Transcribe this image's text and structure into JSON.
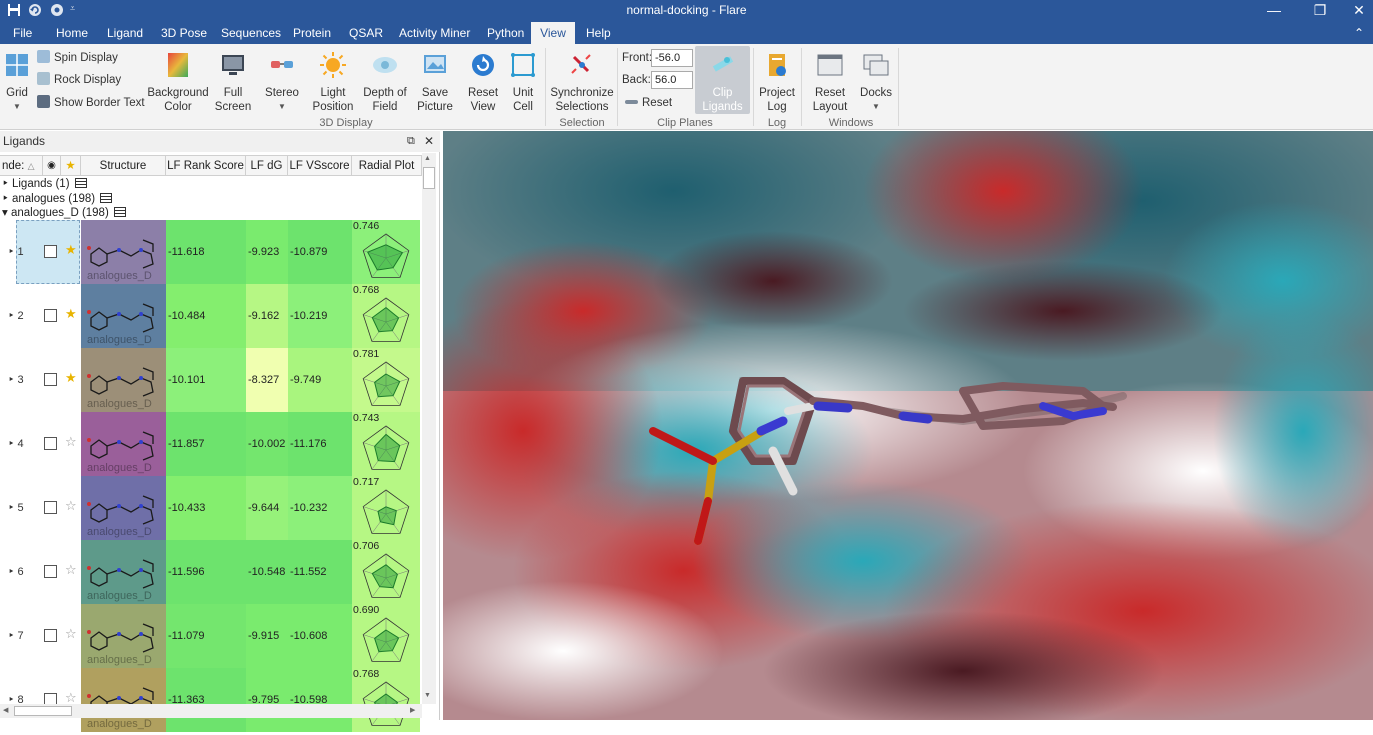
{
  "window": {
    "title": "normal-docking - Flare",
    "minimize": "—",
    "maximize": "❐",
    "close": "✕",
    "collapse_ribbon": "⌃"
  },
  "menu": {
    "items": [
      "File",
      "Home",
      "Ligand",
      "3D Pose",
      "Sequences",
      "Protein",
      "QSAR",
      "Activity Miner",
      "Python",
      "View",
      "Help"
    ],
    "active": "View"
  },
  "ribbon": {
    "grid": "Grid",
    "spin_display": "Spin Display",
    "rock_display": "Rock Display",
    "show_border_text": "Show Border Text",
    "background_color": "Background\nColor",
    "full_screen": "Full\nScreen",
    "stereo": "Stereo",
    "light_position": "Light\nPosition",
    "depth_of_field": "Depth of\nField",
    "save_picture": "Save\nPicture",
    "reset_view": "Reset\nView",
    "unit_cell": "Unit\nCell",
    "group_3d_display": "3D Display",
    "synchronize_selections": "Synchronize\nSelections",
    "group_selection": "Selection",
    "front_label": "Front:",
    "front_value": "-56.0",
    "back_label": "Back:",
    "back_value": "56.0",
    "reset": "Reset",
    "clip_ligands": "Clip\nLigands",
    "group_clip_planes": "Clip Planes",
    "project_log": "Project\nLog",
    "group_log": "Log",
    "reset_layout": "Reset\nLayout",
    "docks": "Docks",
    "group_windows": "Windows"
  },
  "ligands_panel": {
    "title": "Ligands",
    "columns": {
      "index": "nde:",
      "structure": "Structure",
      "lf_rank_score": "LF Rank Score",
      "lf_dg": "LF dG",
      "lf_vsscore": "LF VSscore",
      "radial_plot": "Radial Plot"
    },
    "tree": [
      {
        "label": "Ligands (1)"
      },
      {
        "label": "analogues (198)"
      },
      {
        "label": "analogues_D (198)"
      }
    ],
    "rows": [
      {
        "index": "1",
        "starred": true,
        "struct_label": "analogues_D",
        "rank": "-11.618",
        "dg": "-9.923",
        "vs": "-10.879",
        "radial": "0.746",
        "struct_bg": "#8c7fa8",
        "rank_bg": "#6de36d",
        "dg_bg": "#7aeb6e",
        "vs_bg": "#6de36d",
        "radial_bg": "#8cf07a",
        "shape": [
          0.55,
          0.72,
          0.5,
          0.62,
          0.8
        ]
      },
      {
        "index": "2",
        "starred": true,
        "struct_label": "analogues_D",
        "rank": "-10.484",
        "dg": "-9.162",
        "vs": "-10.219",
        "radial": "0.768",
        "struct_bg": "#5e7fa0",
        "rank_bg": "#84ee6e",
        "dg_bg": "#b6f784",
        "vs_bg": "#8cf07a",
        "radial_bg": "#b6f784",
        "shape": [
          0.6,
          0.55,
          0.45,
          0.5,
          0.6
        ]
      },
      {
        "index": "3",
        "starred": true,
        "struct_label": "analogues_D",
        "rank": "-10.101",
        "dg": "-8.327",
        "vs": "-9.749",
        "radial": "0.781",
        "struct_bg": "#9c8f78",
        "rank_bg": "#8cf07a",
        "dg_bg": "#f0ffb0",
        "vs_bg": "#a9f57e",
        "radial_bg": "#c4f98c",
        "shape": [
          0.5,
          0.6,
          0.5,
          0.55,
          0.5
        ]
      },
      {
        "index": "4",
        "starred": false,
        "struct_label": "analogues_D",
        "rank": "-11.857",
        "dg": "-10.002",
        "vs": "-11.176",
        "radial": "0.743",
        "struct_bg": "#9a5f9a",
        "rank_bg": "#6de36d",
        "dg_bg": "#74e66e",
        "vs_bg": "#6de36d",
        "radial_bg": "#b6f784",
        "shape": [
          0.65,
          0.6,
          0.6,
          0.55,
          0.5
        ]
      },
      {
        "index": "5",
        "starred": false,
        "struct_label": "analogues_D",
        "rank": "-10.433",
        "dg": "-9.644",
        "vs": "-10.232",
        "radial": "0.717",
        "struct_bg": "#6f6fa8",
        "rank_bg": "#84ee6e",
        "dg_bg": "#96f27a",
        "vs_bg": "#8cf07a",
        "radial_bg": "#b6f784",
        "shape": [
          0.3,
          0.45,
          0.55,
          0.4,
          0.35
        ]
      },
      {
        "index": "6",
        "starred": false,
        "struct_label": "analogues_D",
        "rank": "-11.596",
        "dg": "-10.548",
        "vs": "-11.552",
        "radial": "0.706",
        "struct_bg": "#5e9a8a",
        "rank_bg": "#6de36d",
        "dg_bg": "#6de36d",
        "vs_bg": "#6de36d",
        "radial_bg": "#b6f784",
        "shape": [
          0.55,
          0.5,
          0.5,
          0.45,
          0.6
        ]
      },
      {
        "index": "7",
        "starred": false,
        "struct_label": "analogues_D",
        "rank": "-11.079",
        "dg": "-9.915",
        "vs": "-10.608",
        "radial": "0.690",
        "struct_bg": "#9aa86f",
        "rank_bg": "#74e66e",
        "dg_bg": "#7aeb6e",
        "vs_bg": "#7aeb6e",
        "radial_bg": "#b6f784",
        "shape": [
          0.5,
          0.55,
          0.45,
          0.5,
          0.5
        ]
      },
      {
        "index": "8",
        "starred": false,
        "struct_label": "analogues_D",
        "rank": "-11.363",
        "dg": "-9.795",
        "vs": "-10.598",
        "radial": "0.768",
        "struct_bg": "#b0a05f",
        "rank_bg": "#6de36d",
        "dg_bg": "#7aeb6e",
        "vs_bg": "#7aeb6e",
        "radial_bg": "#b6f784",
        "shape": [
          0.5,
          0.5,
          0.5,
          0.5,
          0.5
        ]
      }
    ]
  }
}
